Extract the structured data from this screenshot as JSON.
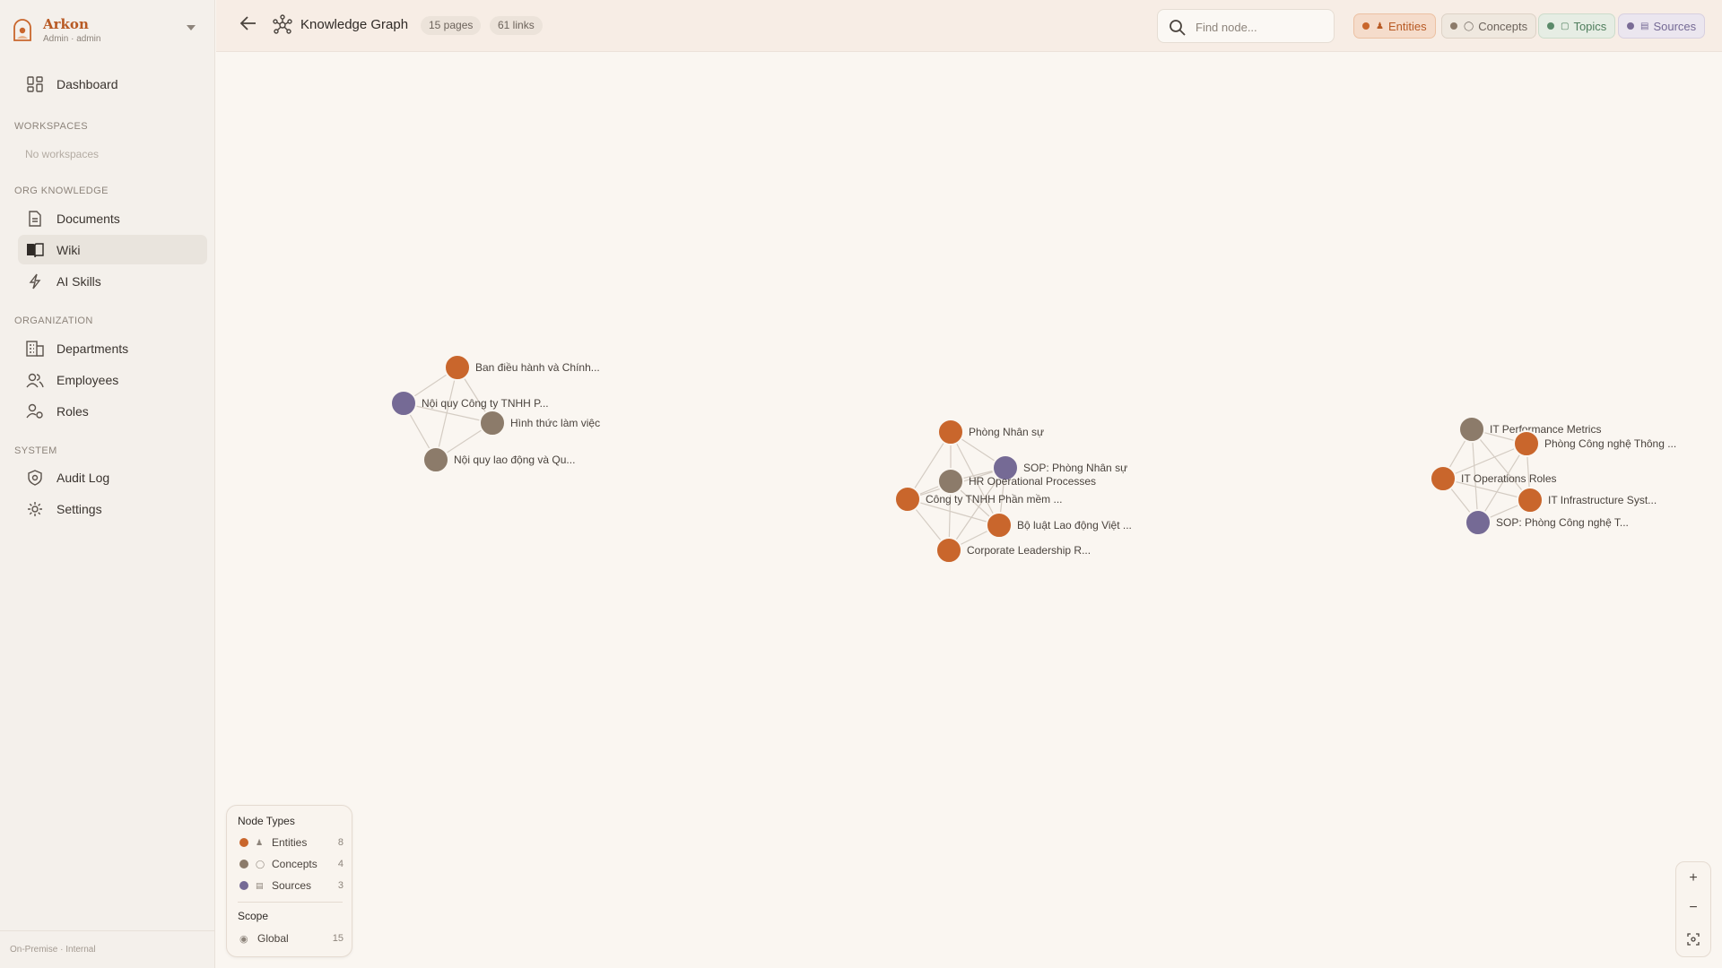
{
  "app": {
    "name": "Arkon",
    "role_line": "Admin · admin",
    "footer": "On-Premise · Internal"
  },
  "sidebar": {
    "dashboard": "Dashboard",
    "sections": {
      "workspaces": "WORKSPACES",
      "org_knowledge": "ORG KNOWLEDGE",
      "organization": "ORGANIZATION",
      "system": "SYSTEM"
    },
    "no_workspaces": "No workspaces",
    "org_items": [
      {
        "label": "Documents",
        "icon": "document-icon"
      },
      {
        "label": "Wiki",
        "icon": "book-icon",
        "active": true
      },
      {
        "label": "AI Skills",
        "icon": "lightning-icon"
      }
    ],
    "organization_items": [
      {
        "label": "Departments",
        "icon": "building-icon"
      },
      {
        "label": "Employees",
        "icon": "users-icon"
      },
      {
        "label": "Roles",
        "icon": "user-gear-icon"
      }
    ],
    "system_items": [
      {
        "label": "Audit Log",
        "icon": "shield-icon"
      },
      {
        "label": "Settings",
        "icon": "gear-icon"
      }
    ]
  },
  "header": {
    "title": "Knowledge Graph",
    "pages": "15 pages",
    "links": "61 links",
    "search_placeholder": "Find node...",
    "filters": [
      {
        "label": "Entities",
        "color": "#c9662c",
        "icon": "person-icon"
      },
      {
        "label": "Concepts",
        "color": "#8c7b6a",
        "icon": "bulb-icon"
      },
      {
        "label": "Topics",
        "color": "#5b8a6a",
        "icon": "folder-icon"
      },
      {
        "label": "Sources",
        "color": "#7a6c96",
        "icon": "document-icon"
      }
    ]
  },
  "graph": {
    "colors": {
      "entity": "#c9662c",
      "concept": "#8c7b6a",
      "source": "#756a95"
    },
    "nodes": [
      {
        "id": "a1",
        "label": "Ban điều hành và Chính...",
        "type": "entity"
      },
      {
        "id": "a2",
        "label": "Nội quy Công ty TNHH P...",
        "type": "source"
      },
      {
        "id": "a3",
        "label": "Hình thức làm việc",
        "type": "concept"
      },
      {
        "id": "a4",
        "label": "Nội quy lao động và Qu...",
        "type": "concept"
      },
      {
        "id": "b1",
        "label": "Phòng Nhân sự",
        "type": "entity"
      },
      {
        "id": "b2",
        "label": "SOP: Phòng Nhân sự",
        "type": "source"
      },
      {
        "id": "b3",
        "label": "HR Operational Processes",
        "type": "concept"
      },
      {
        "id": "b4",
        "label": "Công ty TNHH Phần mềm ...",
        "type": "entity"
      },
      {
        "id": "b5",
        "label": "Bộ luật Lao động Việt ...",
        "type": "entity"
      },
      {
        "id": "b6",
        "label": "Corporate Leadership R...",
        "type": "entity"
      },
      {
        "id": "c1",
        "label": "IT Performance Metrics",
        "type": "concept"
      },
      {
        "id": "c2",
        "label": "Phòng Công nghệ Thông ...",
        "type": "entity"
      },
      {
        "id": "c3",
        "label": "IT Operations Roles",
        "type": "entity"
      },
      {
        "id": "c4",
        "label": "IT Infrastructure Syst...",
        "type": "entity"
      },
      {
        "id": "c5",
        "label": "SOP: Phòng Công nghệ T...",
        "type": "source"
      }
    ],
    "edges": [
      [
        "a1",
        "a2"
      ],
      [
        "a1",
        "a3"
      ],
      [
        "a1",
        "a4"
      ],
      [
        "a2",
        "a3"
      ],
      [
        "a2",
        "a4"
      ],
      [
        "a3",
        "a4"
      ],
      [
        "b1",
        "b2"
      ],
      [
        "b1",
        "b3"
      ],
      [
        "b1",
        "b4"
      ],
      [
        "b1",
        "b5"
      ],
      [
        "b2",
        "b3"
      ],
      [
        "b2",
        "b4"
      ],
      [
        "b2",
        "b5"
      ],
      [
        "b2",
        "b6"
      ],
      [
        "b3",
        "b4"
      ],
      [
        "b3",
        "b5"
      ],
      [
        "b3",
        "b6"
      ],
      [
        "b4",
        "b5"
      ],
      [
        "b4",
        "b6"
      ],
      [
        "b5",
        "b6"
      ],
      [
        "c1",
        "c2"
      ],
      [
        "c1",
        "c3"
      ],
      [
        "c1",
        "c4"
      ],
      [
        "c1",
        "c5"
      ],
      [
        "c2",
        "c3"
      ],
      [
        "c2",
        "c4"
      ],
      [
        "c2",
        "c5"
      ],
      [
        "c3",
        "c4"
      ],
      [
        "c3",
        "c5"
      ],
      [
        "c4",
        "c5"
      ]
    ]
  },
  "legend": {
    "title": "Node Types",
    "types": [
      {
        "label": "Entities",
        "count": "8",
        "color": "#c9662c",
        "icon": "person-icon"
      },
      {
        "label": "Concepts",
        "count": "4",
        "color": "#8c7b6a",
        "icon": "bulb-icon"
      },
      {
        "label": "Sources",
        "count": "3",
        "color": "#756a95",
        "icon": "document-icon"
      }
    ],
    "scope_title": "Scope",
    "scope": {
      "label": "Global",
      "count": "15",
      "icon": "globe-icon"
    }
  },
  "zoom": {
    "in": "+",
    "out": "−"
  }
}
